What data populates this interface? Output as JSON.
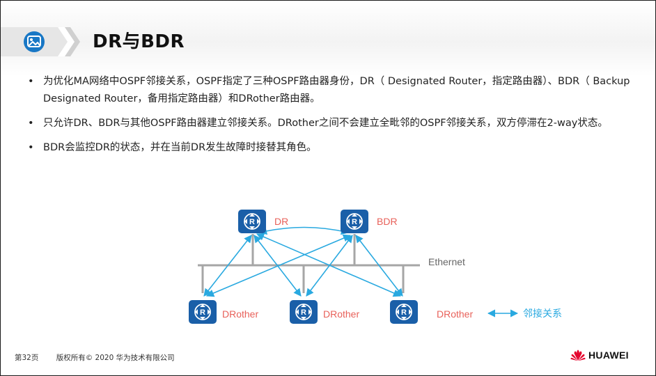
{
  "header": {
    "title": "DR与BDR",
    "icon": "image-icon",
    "accent_color": "#1877c5"
  },
  "bullets": [
    {
      "marker": "•",
      "text": "为优化MA网络中OSPF邻接关系，OSPF指定了三种OSPF路由器身份，DR（ Designated Router，指定路由器）、BDR（ Backup Designated Router，备用指定路由器）和DRother路由器。"
    },
    {
      "marker": "•",
      "text": "只允许DR、BDR与其他OSPF路由器建立邻接关系。DRother之间不会建立全毗邻的OSPF邻接关系，双方停滞在2-way状态。"
    },
    {
      "marker": "•",
      "text": "BDR会监控DR的状态，并在当前DR发生故障时接替其角色。"
    }
  ],
  "diagram": {
    "routers": [
      {
        "label": "DR",
        "icon": "router-icon"
      },
      {
        "label": "BDR",
        "icon": "router-icon"
      },
      {
        "label": "DRother",
        "icon": "router-icon"
      },
      {
        "label": "DRother",
        "icon": "router-icon"
      },
      {
        "label": "DRother",
        "icon": "router-icon"
      }
    ],
    "segment_label": "Ethernet",
    "legend_label": "邻接关系",
    "router_color": "#1a5fa8",
    "label_color": "#e8615a",
    "adjacency_color": "#29a9e0",
    "bus_color": "#a6a6a6"
  },
  "footer": {
    "page": "第32页",
    "copyright": "版权所有© 2020 华为技术有限公司",
    "brand": "HUAWEI",
    "brand_color": "#e4002b"
  }
}
